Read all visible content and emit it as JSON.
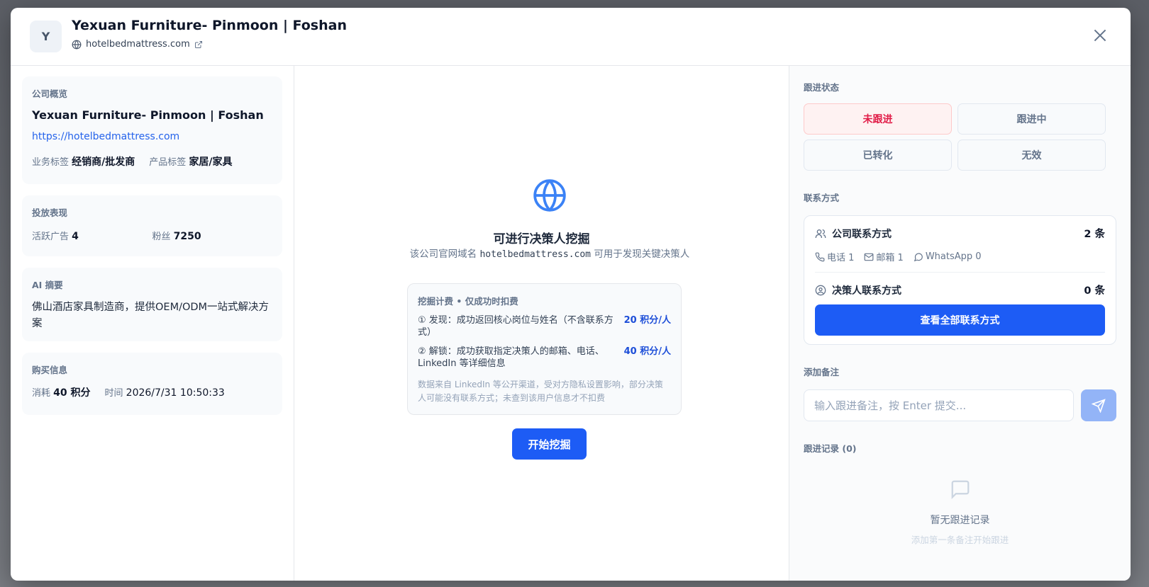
{
  "header": {
    "avatar_letter": "Y",
    "title": "Yexuan Furniture- Pinmoon | Foshan",
    "domain": "hotelbedmattress.com"
  },
  "overview": {
    "label": "公司概览",
    "name": "Yexuan Furniture- Pinmoon | Foshan",
    "url": "https://hotelbedmattress.com",
    "business_tag_key": "业务标签",
    "business_tag_value": "经销商/批发商",
    "product_tag_key": "产品标签",
    "product_tag_value": "家居/家具"
  },
  "performance": {
    "label": "投放表现",
    "active_ads_key": "活跃广告",
    "active_ads_value": "4",
    "fans_key": "粉丝",
    "fans_value": "7250"
  },
  "ai_summary": {
    "label": "AI 摘要",
    "text": "佛山酒店家具制造商，提供OEM/ODM一站式解决方案"
  },
  "purchase": {
    "label": "购买信息",
    "cost_key": "消耗",
    "cost_value": "40 积分",
    "time_key": "时间",
    "time_value": "2026/7/31 10:50:33"
  },
  "mining": {
    "title": "可进行决策人挖掘",
    "desc_prefix": "该公司官网域名",
    "desc_domain": "hotelbedmattress.com",
    "desc_suffix": "可用于发现关键决策人",
    "fee_title": "挖掘计费 • 仅成功时扣费",
    "fee_items": [
      {
        "text": "① 发现：成功返回核心岗位与姓名（不含联系方式）",
        "price": "20 积分/人"
      },
      {
        "text": "② 解锁：成功获取指定决策人的邮箱、电话、LinkedIn 等详细信息",
        "price": "40 积分/人"
      }
    ],
    "note": "数据来自 LinkedIn 等公开渠道，受对方隐私设置影响，部分决策人可能没有联系方式；未查到该用户信息才不扣费",
    "start_label": "开始挖掘"
  },
  "follow_status": {
    "label": "跟进状态",
    "options": [
      "未跟进",
      "跟进中",
      "已转化",
      "无效"
    ],
    "active": "未跟进"
  },
  "contacts": {
    "label": "联系方式",
    "company_label": "公司联系方式",
    "company_count": "2 条",
    "phone": "电话 1",
    "email": "邮箱 1",
    "whatsapp": "WhatsApp 0",
    "decision_label": "决策人联系方式",
    "decision_count": "0 条",
    "view_all_label": "查看全部联系方式"
  },
  "notes": {
    "label": "添加备注",
    "placeholder": "输入跟进备注，按 Enter 提交..."
  },
  "records": {
    "label": "跟进记录 (0)",
    "empty_title": "暂无跟进记录",
    "empty_sub": "添加第一条备注开始跟进"
  },
  "colors": {
    "primary": "#1d5cf5",
    "active_status": "#e11d48",
    "link": "#2563eb"
  }
}
